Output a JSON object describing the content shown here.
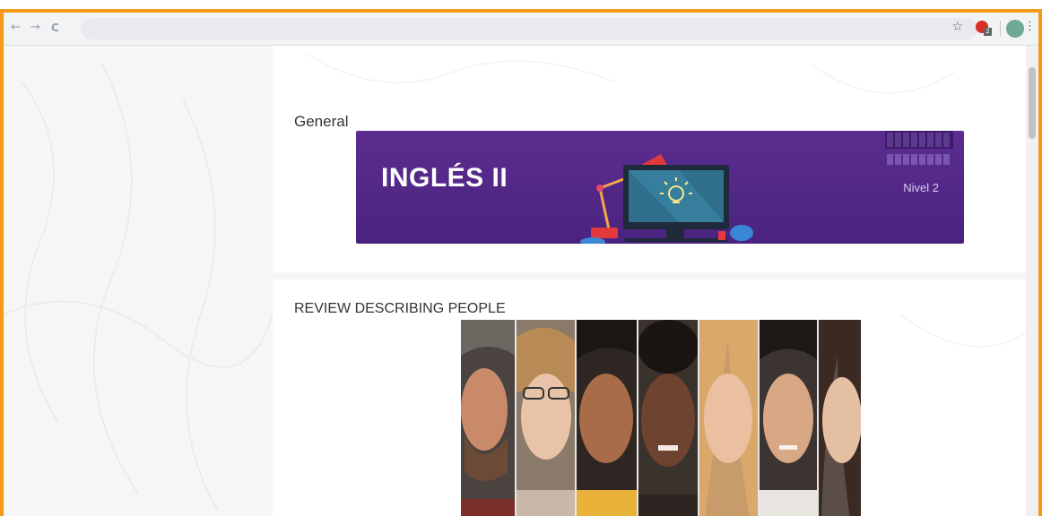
{
  "browser": {
    "back_glyph": "←",
    "forward_glyph": "→",
    "reload_glyph": "C",
    "star_glyph": "☆",
    "extension_badge": "2",
    "menu_glyph": "⋮",
    "address": ""
  },
  "colors": {
    "frame": "#f39a1c",
    "banner": "#5b2d8f",
    "ext_icon": "#d93025",
    "avatar": "#6fa893"
  },
  "course": {
    "section1_title": "General",
    "banner_title": "INGLÉS II",
    "banner_level": "Nivel 2",
    "section2_title": "REVIEW DESCRIBING PEOPLE"
  },
  "icons": [
    "back-icon",
    "forward-icon",
    "reload-icon",
    "star-icon",
    "extension-icon",
    "avatar-icon",
    "menu-icon",
    "desk-lamp-icon",
    "monitor-icon",
    "lightbulb-icon",
    "teapot-icon"
  ]
}
